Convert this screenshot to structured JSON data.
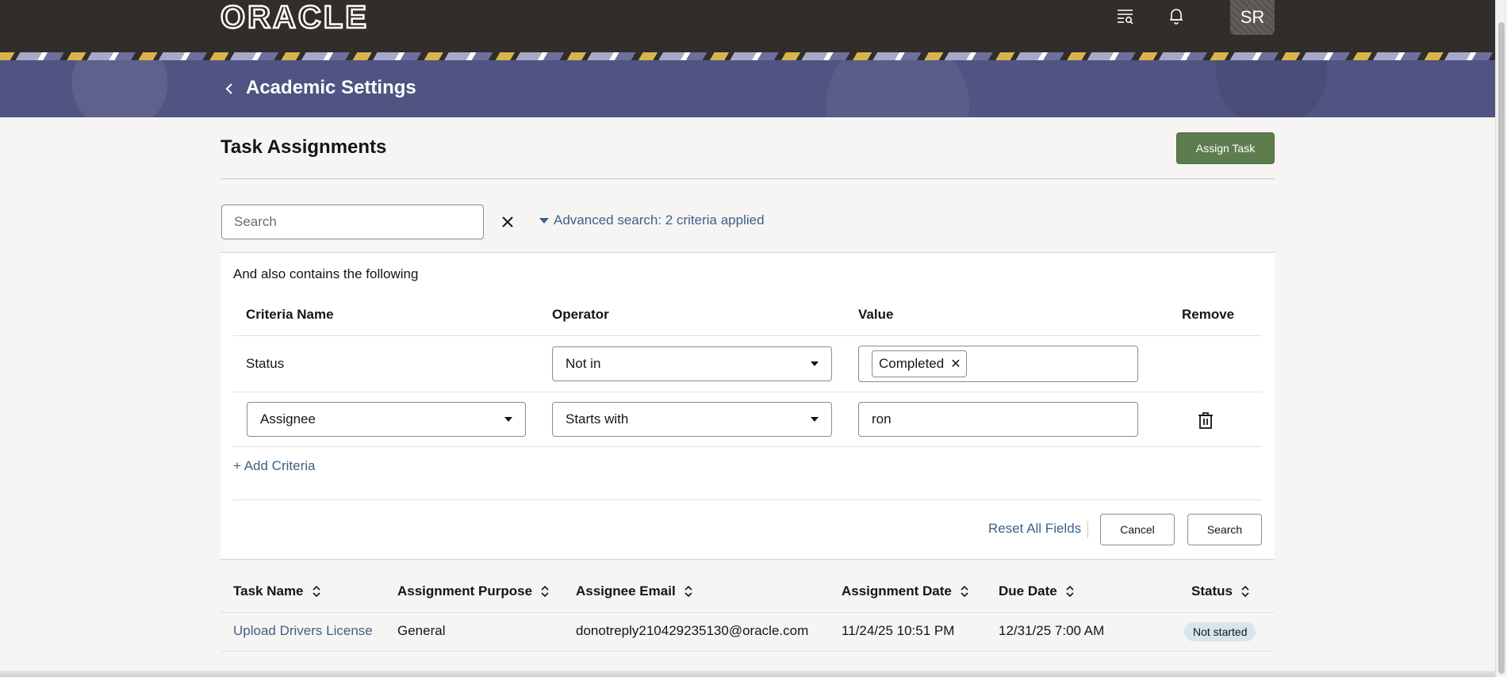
{
  "header": {
    "logo": "ORACLE",
    "icons": [
      "search-list-icon",
      "bell-icon"
    ],
    "avatar_initials": "SR"
  },
  "banner": {
    "title": "Academic Settings"
  },
  "page": {
    "title": "Task Assignments",
    "assign_task_label": "Assign Task"
  },
  "search": {
    "placeholder": "Search",
    "advanced_label": "Advanced search: 2 criteria applied"
  },
  "advanced": {
    "intro": "And also contains the following",
    "columns": [
      "Criteria Name",
      "Operator",
      "Value",
      "Remove"
    ],
    "rows": [
      {
        "criteria": "Status",
        "operator": "Not in",
        "value_chip": "Completed"
      },
      {
        "criteria": "Assignee",
        "operator": "Starts with",
        "value": "ron"
      }
    ],
    "add_criteria_label": "+ Add Criteria",
    "reset_label": "Reset All Fields",
    "cancel_label": "Cancel",
    "search_label": "Search"
  },
  "table": {
    "columns": [
      "Task Name",
      "Assignment Purpose",
      "Assignee Email",
      "Assignment Date",
      "Due Date",
      "Status"
    ],
    "rows": [
      {
        "task_name": "Upload Drivers License",
        "purpose": "General",
        "email": "donotreply210429235130@oracle.com",
        "assignment_date": "11/24/25 10:51 PM",
        "due_date": "12/31/25 7:00 AM",
        "status": "Not started"
      }
    ]
  },
  "colors": {
    "header_bg": "#312d2a",
    "banner_bg": "#4f5482",
    "primary_button": "#5e7d4e",
    "link": "#3e6187",
    "status_badge": "#d7e5ec"
  }
}
